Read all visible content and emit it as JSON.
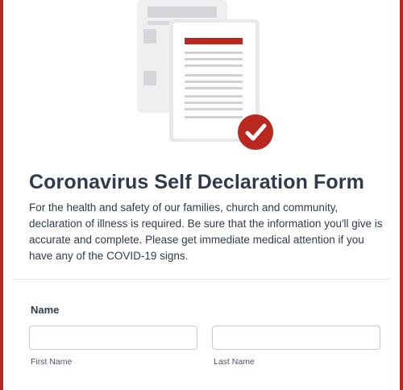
{
  "form": {
    "title": "Coronavirus Self Declaration Form",
    "description": "For the health and safety of our families, church and community, declaration of illness is required. Be sure that the information you'll give is accurate and complete. Please get immediate medical attention if you have any of the COVID-19 signs."
  },
  "name_field": {
    "label": "Name",
    "first_name": {
      "value": "",
      "sublabel": "First Name"
    },
    "last_name": {
      "value": "",
      "sublabel": "Last Name"
    }
  },
  "icons": {
    "illustration": "documents-checkmark-icon",
    "check": "check-icon"
  },
  "colors": {
    "accent": "#b8281f",
    "text": "#2f3a4e",
    "input_border": "#c3cad8",
    "document_gray": "#e6e7e9"
  }
}
